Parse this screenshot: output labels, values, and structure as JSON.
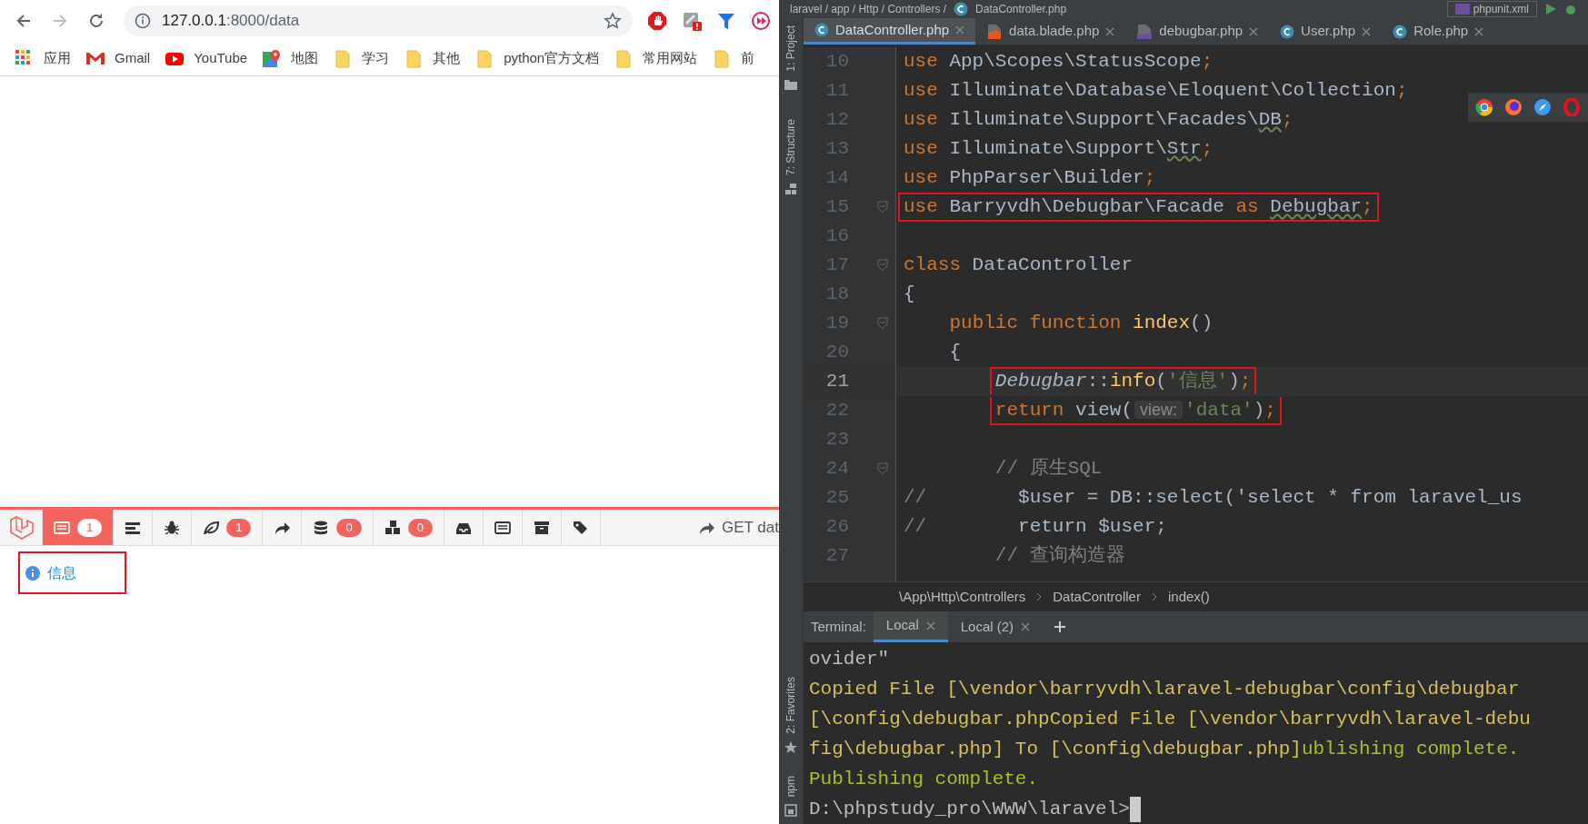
{
  "browser": {
    "nav": [
      {
        "kind": "back",
        "disabled": false
      },
      {
        "kind": "forward",
        "disabled": true
      },
      {
        "kind": "reload",
        "disabled": false
      }
    ],
    "address": {
      "host": "127.0.0.1",
      "path": ":8000/data"
    },
    "extensions": [
      {
        "kind": "stop"
      },
      {
        "kind": "puzzle"
      },
      {
        "kind": "funnel"
      },
      {
        "kind": "forward"
      }
    ],
    "bookmarks": [
      {
        "kind": "apps",
        "label": "应用"
      },
      {
        "kind": "gmail",
        "label": "Gmail"
      },
      {
        "kind": "youtube",
        "label": "YouTube"
      },
      {
        "kind": "maps",
        "label": "地图"
      },
      {
        "kind": "folder",
        "label": "学习"
      },
      {
        "kind": "folder",
        "label": "其他"
      },
      {
        "kind": "folder",
        "label": "python官方文档"
      },
      {
        "kind": "folder",
        "label": "常用网站"
      },
      {
        "kind": "folder",
        "label": "前"
      }
    ],
    "debugbar": {
      "tabs": [
        {
          "kind": "messages",
          "badge": "1",
          "selected": true
        },
        {
          "kind": "timeline",
          "selected": false
        },
        {
          "kind": "exceptions",
          "selected": false
        },
        {
          "kind": "views",
          "badge": "1",
          "selected": false
        },
        {
          "kind": "route",
          "selected": false
        },
        {
          "kind": "queries",
          "badge": "0",
          "selected": false
        },
        {
          "kind": "models",
          "badge": "0",
          "selected": false
        },
        {
          "kind": "mails",
          "selected": false
        },
        {
          "kind": "gate",
          "selected": false
        },
        {
          "kind": "session",
          "selected": false
        },
        {
          "kind": "request",
          "selected": false
        }
      ],
      "request": "GET dat"
    },
    "messages": [
      {
        "kind": "info",
        "text": "信息",
        "boxed": true
      }
    ]
  },
  "ide": {
    "nav_path": "laravel / app / Http / Controllers /",
    "nav_file": "DataController.php",
    "run_config": "phpunit.xml",
    "tool_windows_top": [
      "1: Project",
      "7: Structure"
    ],
    "tool_windows_bottom": [
      "2: Favorites",
      "npm"
    ],
    "tabs": [
      {
        "kind": "class",
        "label": "DataController.php",
        "selected": true
      },
      {
        "kind": "blade",
        "label": "data.blade.php",
        "selected": false
      },
      {
        "kind": "php",
        "label": "debugbar.php",
        "selected": false
      },
      {
        "kind": "class",
        "label": "User.php",
        "selected": false
      },
      {
        "kind": "class",
        "label": "Role.php",
        "selected": false
      }
    ],
    "lines": [
      {
        "number": "10",
        "tokens": [
          {
            "kind": "keyword",
            "text": "use"
          },
          {
            "kind": "plain",
            "text": " App\\Scopes\\StatusScope"
          },
          {
            "kind": "keyword",
            "text": ";"
          }
        ]
      },
      {
        "number": "11",
        "tokens": [
          {
            "kind": "keyword",
            "text": "use"
          },
          {
            "kind": "plain",
            "text": " Illuminate\\Database\\Eloquent\\Collection"
          },
          {
            "kind": "keyword",
            "text": ";"
          }
        ]
      },
      {
        "number": "12",
        "tokens": [
          {
            "kind": "keyword",
            "text": "use"
          },
          {
            "kind": "plain",
            "text": " Illuminate\\Support\\Facades\\"
          },
          {
            "kind": "typo",
            "text": "DB"
          },
          {
            "kind": "keyword",
            "text": ";"
          }
        ]
      },
      {
        "number": "13",
        "tokens": [
          {
            "kind": "keyword",
            "text": "use"
          },
          {
            "kind": "plain",
            "text": " Illuminate\\Support\\"
          },
          {
            "kind": "typo",
            "text": "Str"
          },
          {
            "kind": "keyword",
            "text": ";"
          }
        ]
      },
      {
        "number": "14",
        "tokens": [
          {
            "kind": "keyword",
            "text": "use"
          },
          {
            "kind": "plain",
            "text": " PhpParser\\Builder"
          },
          {
            "kind": "keyword",
            "text": ";"
          }
        ]
      },
      {
        "number": "15",
        "boxed": true,
        "fold": true,
        "tokens": [
          {
            "kind": "keyword",
            "text": "use"
          },
          {
            "kind": "plain",
            "text": " Barryvdh\\Debugbar\\Facade "
          },
          {
            "kind": "keyword",
            "text": "as "
          },
          {
            "kind": "typo",
            "text": "Debugbar"
          },
          {
            "kind": "keyword",
            "text": ";"
          }
        ]
      },
      {
        "number": "16"
      },
      {
        "number": "17",
        "fold": true,
        "tokens": [
          {
            "kind": "keyword",
            "text": "class"
          },
          {
            "kind": "plain",
            "text": " DataController"
          }
        ]
      },
      {
        "number": "18",
        "tokens": [
          {
            "kind": "plain",
            "text": "{"
          }
        ]
      },
      {
        "number": "19",
        "fold": true,
        "tokens": [
          {
            "kind": "keyword",
            "text": "    public function "
          },
          {
            "kind": "func",
            "text": "index"
          },
          {
            "kind": "plain",
            "text": "()"
          }
        ]
      },
      {
        "number": "20",
        "tokens": [
          {
            "kind": "plain",
            "text": "    {"
          }
        ]
      },
      {
        "number": "21",
        "current": true,
        "boxed": true,
        "tokens": [
          {
            "kind": "static",
            "text": "        Debugbar"
          },
          {
            "kind": "plain",
            "text": "::"
          },
          {
            "kind": "func",
            "text": "info"
          },
          {
            "kind": "plain",
            "text": "("
          },
          {
            "kind": "string",
            "text": "'信息'"
          },
          {
            "kind": "plain",
            "text": ")"
          },
          {
            "kind": "keyword",
            "text": ";"
          }
        ]
      },
      {
        "number": "22",
        "boxed": true,
        "tokens": [
          {
            "kind": "keyword",
            "text": "        return"
          },
          {
            "kind": "plain",
            "text": " view("
          },
          {
            "kind": "hint",
            "text": "view:"
          },
          {
            "kind": "string",
            "text": "'data'"
          },
          {
            "kind": "plain",
            "text": ")"
          },
          {
            "kind": "keyword",
            "text": ";"
          }
        ]
      },
      {
        "number": "23"
      },
      {
        "number": "24",
        "fold": true,
        "tokens": [
          {
            "kind": "comment",
            "text": "        // 原生SQL"
          }
        ]
      },
      {
        "number": "25",
        "tokens": [
          {
            "kind": "comment",
            "text": "//"
          },
          {
            "kind": "plain",
            "text": "        $user = DB::select('select * from laravel_us"
          }
        ]
      },
      {
        "number": "26",
        "tokens": [
          {
            "kind": "comment",
            "text": "//"
          },
          {
            "kind": "plain",
            "text": "        return $user;"
          }
        ]
      },
      {
        "number": "27",
        "tokens": [
          {
            "kind": "comment",
            "text": "        // 查询构造器"
          }
        ]
      }
    ],
    "breadcrumbs": [
      "\\App\\Http\\Controllers",
      "DataController",
      "index()"
    ],
    "terminal": {
      "label": "Terminal:",
      "tabs": [
        {
          "label": "Local",
          "selected": true
        },
        {
          "label": "Local (2)",
          "selected": false
        }
      ],
      "lines": [
        {
          "segments": [
            {
              "kind": "output",
              "text": "ovider\""
            }
          ]
        },
        {
          "segments": [
            {
              "kind": "copied",
              "text": "Copied File [\\vendor\\barryvdh\\laravel-debugbar\\config\\debugbar"
            }
          ]
        },
        {
          "segments": [
            {
              "kind": "copied",
              "text": "[\\config\\debugbar.phpCopied File [\\vendor\\barryvdh\\laravel-debu"
            }
          ]
        },
        {
          "segments": [
            {
              "kind": "copied",
              "text": "fig\\debugbar.php] To [\\config\\debugbar.php]"
            },
            {
              "kind": "done",
              "text": "ublishing complete."
            }
          ]
        },
        {
          "segments": [
            {
              "kind": "done",
              "text": "Publishing complete."
            }
          ]
        },
        {
          "segments": [
            {
              "kind": "output",
              "text": "D:\\phpstudy_pro\\WWW\\laravel>"
            }
          ],
          "cursor": true
        }
      ]
    }
  }
}
